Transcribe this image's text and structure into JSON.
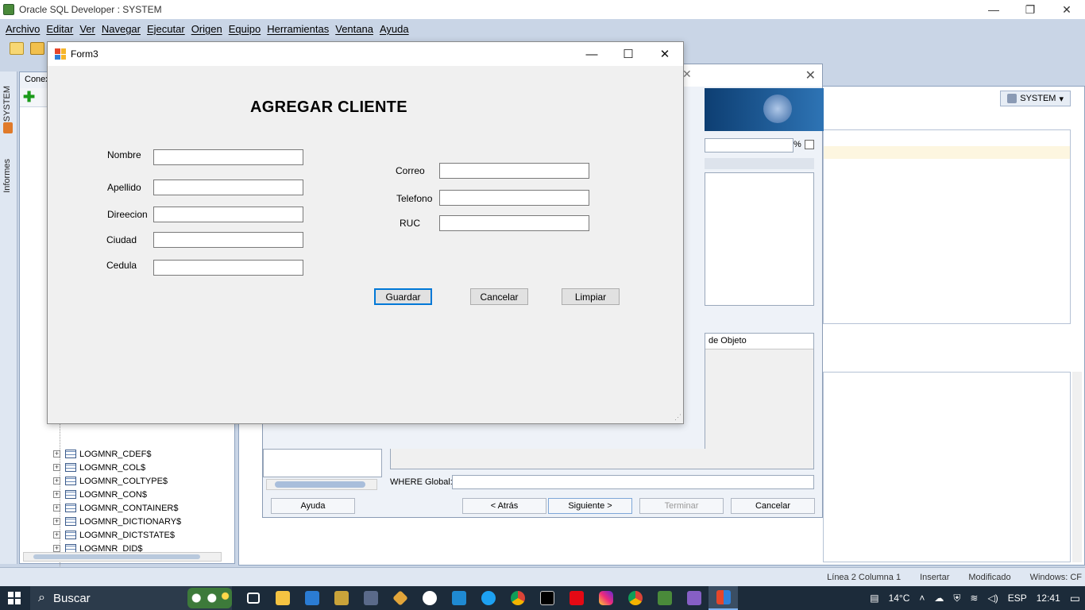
{
  "ide": {
    "title": "Oracle SQL Developer : SYSTEM",
    "menu": [
      "Archivo",
      "Editar",
      "Ver",
      "Navegar",
      "Ejecutar",
      "Origen",
      "Equipo",
      "Herramientas",
      "Ventana",
      "Ayuda"
    ],
    "side_tabs": [
      "SYSTEM",
      "Informes"
    ],
    "conn_tab": "Conex",
    "tree_items": [
      "LOGMNR_CDEF$",
      "LOGMNR_COL$",
      "LOGMNR_COLTYPE$",
      "LOGMNR_CON$",
      "LOGMNR_CONTAINER$",
      "LOGMNR_DICTIONARY$",
      "LOGMNR_DICTSTATE$",
      "LOGMNR_DID$"
    ],
    "conn_label": "SYSTEM",
    "status": [
      "Línea 2 Columna 1",
      "Insertar",
      "Modificado",
      "Windows: CF"
    ]
  },
  "wizard": {
    "pct_label": "%",
    "table_header": "de Objeto",
    "where_label": "WHERE Global:",
    "buttons": {
      "help": "Ayuda",
      "back": "< Atrás",
      "next": "Siguiente >",
      "finish": "Terminar",
      "cancel": "Cancelar"
    }
  },
  "form3": {
    "window_title": "Form3",
    "heading": "AGREGAR CLIENTE",
    "fields_left": [
      {
        "label": "Nombre",
        "value": ""
      },
      {
        "label": "Apellido",
        "value": ""
      },
      {
        "label": "Direecion",
        "value": ""
      },
      {
        "label": "Ciudad",
        "value": ""
      },
      {
        "label": "Cedula",
        "value": ""
      }
    ],
    "fields_right": [
      {
        "label": "Correo",
        "value": ""
      },
      {
        "label": "Telefono",
        "value": ""
      },
      {
        "label": "RUC",
        "value": ""
      }
    ],
    "buttons": {
      "save": "Guardar",
      "cancel": "Cancelar",
      "clear": "Limpiar"
    }
  },
  "taskbar": {
    "search_placeholder": "Buscar",
    "temperature": "14°C",
    "language": "ESP",
    "time": "12:41"
  }
}
